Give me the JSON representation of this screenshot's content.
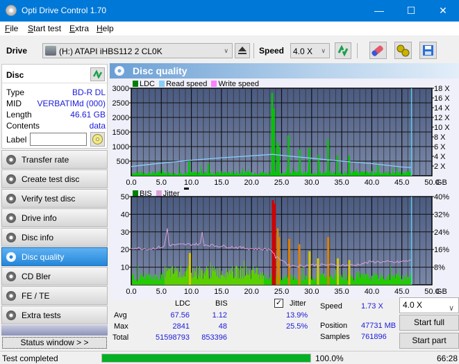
{
  "window": {
    "title": "Opti Drive Control 1.70",
    "minimize": "—",
    "maximize": "☐",
    "close": "✕"
  },
  "menu": [
    {
      "label": "File",
      "accel": "F",
      "rest": "ile"
    },
    {
      "label": "Start test",
      "accel": "S",
      "rest": "tart test"
    },
    {
      "label": "Extra",
      "accel": "E",
      "rest": "xtra"
    },
    {
      "label": "Help",
      "accel": "H",
      "rest": "elp"
    }
  ],
  "toolbar": {
    "drive_label": "Drive",
    "drive_value": "(H:)  ATAPI iHBS112  2 CL0K",
    "speed_label": "Speed",
    "speed_value": "4.0 X",
    "icons": [
      "refresh-icon",
      "eraser-icon",
      "settings-icon",
      "save-icon"
    ]
  },
  "disc": {
    "header": "Disc",
    "rows": [
      {
        "key": "Type",
        "value": "BD-R DL"
      },
      {
        "key": "MID",
        "value": "VERBATIMd (000)"
      },
      {
        "key": "Length",
        "value": "46.61 GB"
      },
      {
        "key": "Contents",
        "value": "data"
      }
    ],
    "label_key": "Label",
    "label_value": ""
  },
  "nav": [
    {
      "label": "Transfer rate",
      "active": false
    },
    {
      "label": "Create test disc",
      "active": false
    },
    {
      "label": "Verify test disc",
      "active": false
    },
    {
      "label": "Drive info",
      "active": false
    },
    {
      "label": "Disc info",
      "active": false
    },
    {
      "label": "Disc quality",
      "active": true
    },
    {
      "label": "CD Bler",
      "active": false
    },
    {
      "label": "FE / TE",
      "active": false
    },
    {
      "label": "Extra tests",
      "active": false
    }
  ],
  "status_window_label": "Status window > >",
  "panel_title": "Disc quality",
  "colors": {
    "ldc": "#00c800",
    "read_speed": "#87cefa",
    "write_speed": "#ff80ff",
    "bis": "#00c800",
    "jitter": "#d8a0d8",
    "plot_bg_top": "#4a5a80",
    "plot_bg_bottom": "#7a88a8",
    "accent": "#0078d7"
  },
  "chart_data": [
    {
      "type": "bar",
      "title": "LDC / Read speed",
      "legend": [
        "LDC",
        "Read speed",
        "Write speed"
      ],
      "xlabel": "GB",
      "x_ticks": [
        "0.0",
        "5.0",
        "10.0",
        "15.0",
        "20.0",
        "25.0",
        "30.0",
        "35.0",
        "40.0",
        "45.0",
        "50.0"
      ],
      "xlim": [
        0,
        50
      ],
      "y_left_ticks": [
        "500",
        "1000",
        "1500",
        "2000",
        "2500",
        "3000"
      ],
      "ylim_left": [
        0,
        3000
      ],
      "y_right_ticks": [
        "2 X",
        "4 X",
        "6 X",
        "8 X",
        "10 X",
        "12 X",
        "14 X",
        "16 X",
        "18 X"
      ],
      "ylim_right": [
        0,
        18
      ],
      "ldc_spikes": [
        {
          "x": 9.6,
          "y": 500
        },
        {
          "x": 12.8,
          "y": 420
        },
        {
          "x": 23.4,
          "y": 2841
        },
        {
          "x": 23.7,
          "y": 2300
        },
        {
          "x": 24.3,
          "y": 1150
        },
        {
          "x": 24.5,
          "y": 1000
        },
        {
          "x": 26.1,
          "y": 1380
        },
        {
          "x": 28.0,
          "y": 900
        },
        {
          "x": 29.6,
          "y": 960
        },
        {
          "x": 31.1,
          "y": 720
        },
        {
          "x": 32.7,
          "y": 1250
        },
        {
          "x": 34.3,
          "y": 700
        },
        {
          "x": 36.2,
          "y": 680
        },
        {
          "x": 41.0,
          "y": 350
        }
      ],
      "ldc_baseline": 110,
      "read_speed": [
        {
          "x": 0,
          "y": 1.9
        },
        {
          "x": 5,
          "y": 2.6
        },
        {
          "x": 10,
          "y": 3.2
        },
        {
          "x": 15,
          "y": 3.7
        },
        {
          "x": 20,
          "y": 4.1
        },
        {
          "x": 23.5,
          "y": 4.4
        },
        {
          "x": 25,
          "y": 4.2
        },
        {
          "x": 30,
          "y": 3.6
        },
        {
          "x": 35,
          "y": 3.0
        },
        {
          "x": 40,
          "y": 2.5
        },
        {
          "x": 45,
          "y": 1.8
        },
        {
          "x": 46.6,
          "y": 1.7
        }
      ],
      "end_marker_x": 46.6
    },
    {
      "type": "bar",
      "title": "BIS / Jitter",
      "legend": [
        "BIS",
        "Jitter"
      ],
      "xlabel": "GB",
      "x_ticks": [
        "0.0",
        "5.0",
        "10.0",
        "15.0",
        "20.0",
        "25.0",
        "30.0",
        "35.0",
        "40.0",
        "45.0",
        "50.0"
      ],
      "xlim": [
        0,
        50
      ],
      "y_left_ticks": [
        "10",
        "20",
        "30",
        "40",
        "50"
      ],
      "ylim_left": [
        0,
        50
      ],
      "y_right_ticks": [
        "8%",
        "16%",
        "24%",
        "32%",
        "40%"
      ],
      "ylim_right": [
        0,
        40
      ],
      "bis_spikes": [
        {
          "x": 9.7,
          "y": 18
        },
        {
          "x": 23.5,
          "y": 48
        },
        {
          "x": 23.8,
          "y": 46
        },
        {
          "x": 24.3,
          "y": 32
        },
        {
          "x": 24.5,
          "y": 27
        },
        {
          "x": 26.2,
          "y": 26
        },
        {
          "x": 27.9,
          "y": 23
        },
        {
          "x": 29.6,
          "y": 19
        },
        {
          "x": 31.0,
          "y": 15
        },
        {
          "x": 32.7,
          "y": 27
        },
        {
          "x": 34.3,
          "y": 15
        },
        {
          "x": 36.2,
          "y": 14
        }
      ],
      "bis_baseline": 4,
      "jitter": [
        {
          "x": 0,
          "y": 16.8
        },
        {
          "x": 3,
          "y": 16.2
        },
        {
          "x": 5.5,
          "y": 17.4
        },
        {
          "x": 6.0,
          "y": 25.5
        },
        {
          "x": 6.3,
          "y": 18.0
        },
        {
          "x": 11.5,
          "y": 18.5
        },
        {
          "x": 11.8,
          "y": 24.0
        },
        {
          "x": 12.1,
          "y": 18.2
        },
        {
          "x": 20,
          "y": 16.4
        },
        {
          "x": 23.3,
          "y": 16.0
        },
        {
          "x": 24.0,
          "y": 12.5
        },
        {
          "x": 25.0,
          "y": 11.5
        },
        {
          "x": 26.2,
          "y": 8.8
        },
        {
          "x": 28.0,
          "y": 8.5
        },
        {
          "x": 30,
          "y": 9.0
        },
        {
          "x": 34,
          "y": 9.0
        },
        {
          "x": 37,
          "y": 8.8
        },
        {
          "x": 40,
          "y": 10.5
        },
        {
          "x": 44,
          "y": 10.2
        },
        {
          "x": 46.6,
          "y": 11.0
        }
      ],
      "end_marker_x": 46.6
    }
  ],
  "stats": {
    "col_ldc": "LDC",
    "col_bis": "BIS",
    "jitter_label": "Jitter",
    "jitter_checked": true,
    "avg_label": "Avg",
    "max_label": "Max",
    "total_label": "Total",
    "ldc_avg": "67.56",
    "ldc_max": "2841",
    "ldc_total": "51598793",
    "bis_avg": "1.12",
    "bis_max": "48",
    "bis_total": "853396",
    "jitter_avg": "13.9%",
    "jitter_max": "25.5%",
    "speed_label": "Speed",
    "speed_value": "1.73 X",
    "position_label": "Position",
    "position_value": "47731 MB",
    "samples_label": "Samples",
    "samples_value": "761896",
    "speed_select": "4.0 X",
    "start_full": "Start full",
    "start_part": "Start part"
  },
  "statusbar": {
    "text": "Test completed",
    "progress_percent": 100.0,
    "progress_label": "100.0%",
    "time": "66:28"
  }
}
